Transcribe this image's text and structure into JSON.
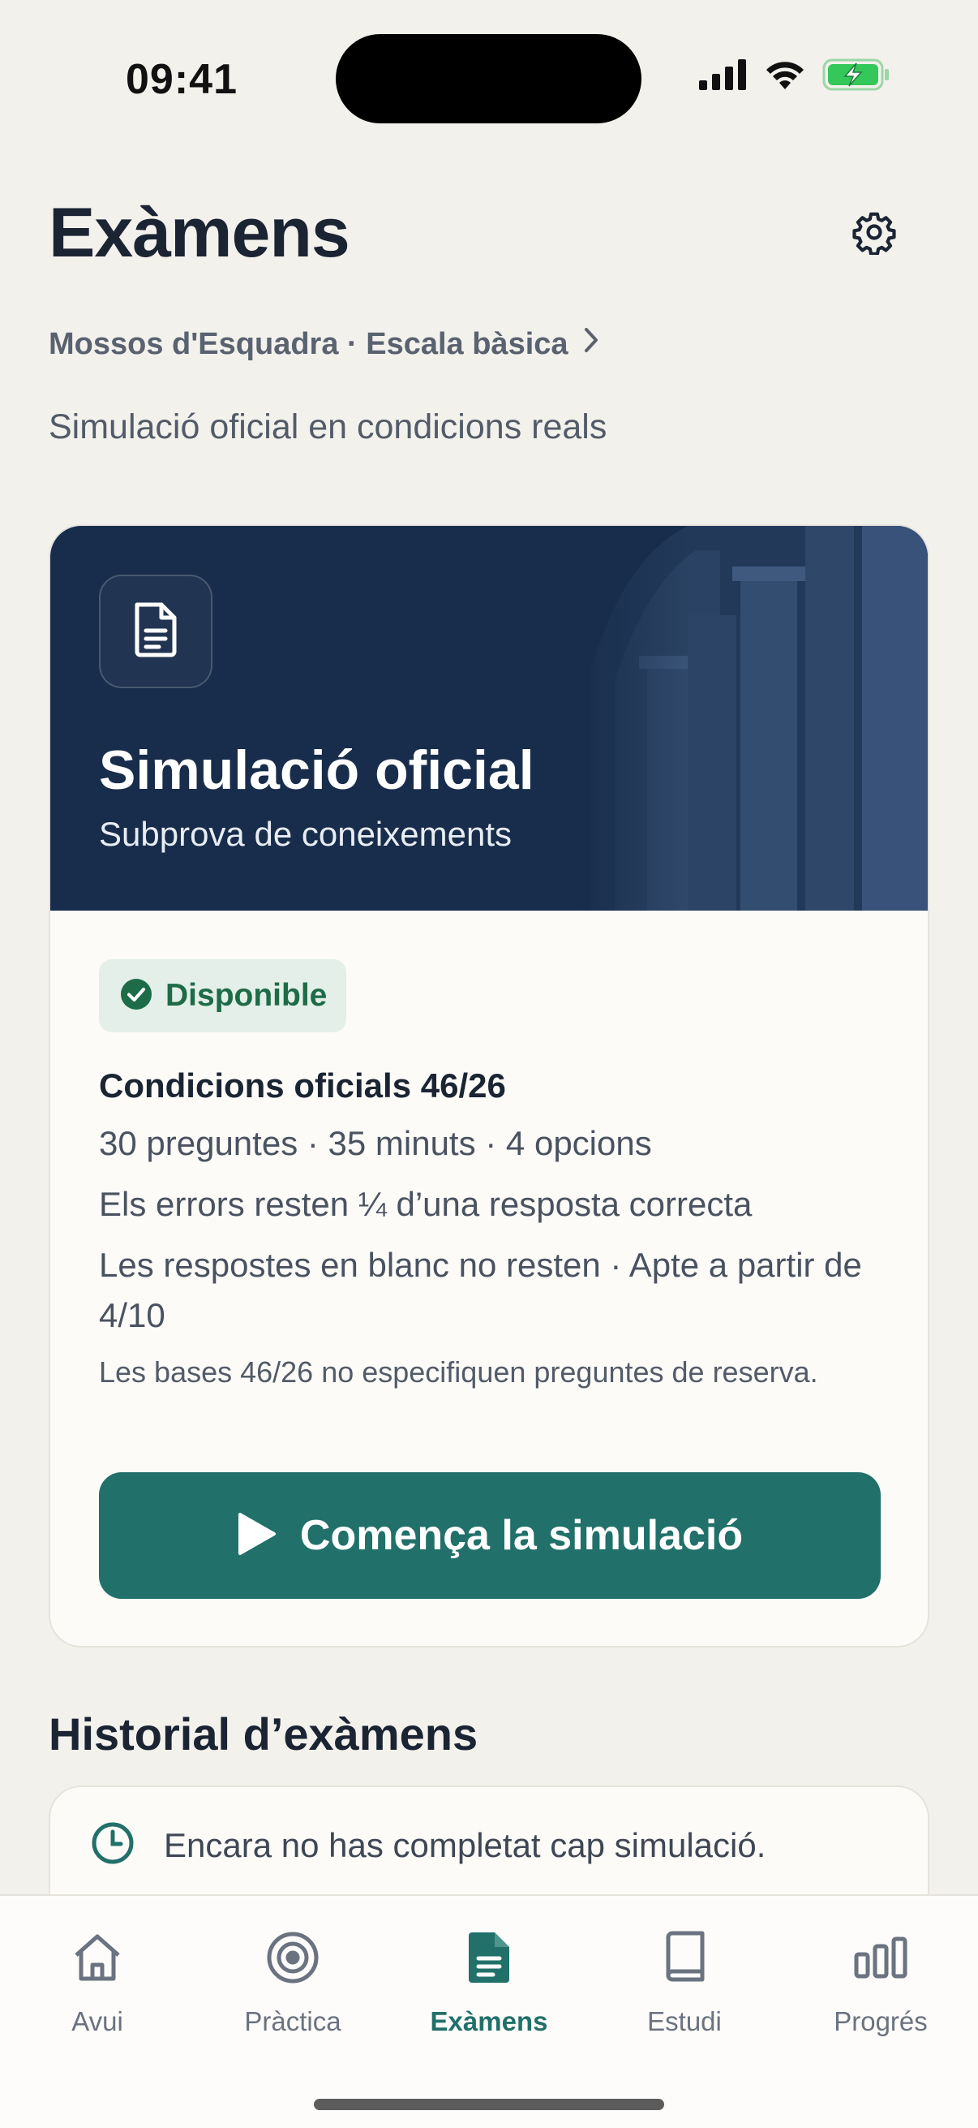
{
  "status_bar": {
    "time": "09:41",
    "icons": [
      "signal-icon",
      "wifi-icon",
      "battery-charging-icon"
    ]
  },
  "header": {
    "title": "Exàmens",
    "settings_icon": "gear-icon",
    "breadcrumb": "Mossos d'Esquadra · Escala bàsica",
    "subtitle": "Simulació oficial en condicions reals"
  },
  "simulation_card": {
    "hero_icon": "document-icon",
    "title": "Simulació oficial",
    "subtitle": "Subprova de coneixements",
    "badge": "Disponible",
    "conditions_title": "Condicions oficials 46/26",
    "lines": [
      "30 preguntes · 35 minuts · 4 opcions",
      "Els errors resten ¼ d’una resposta correcta",
      "Les respostes en blanc no resten · Apte a partir de 4/10"
    ],
    "note": "Les bases 46/26 no especifiquen preguntes de reserva.",
    "start_button": "Comença la simulació"
  },
  "history": {
    "title": "Historial d’exàmens",
    "empty_text": "Encara no has completat cap simulació."
  },
  "tab_bar": {
    "active": "Exàmens",
    "tabs": [
      {
        "label": "Avui",
        "icon": "home-icon"
      },
      {
        "label": "Pràctica",
        "icon": "target-icon"
      },
      {
        "label": "Exàmens",
        "icon": "document-icon"
      },
      {
        "label": "Estudi",
        "icon": "book-icon"
      },
      {
        "label": "Progrés",
        "icon": "bar-chart-icon"
      }
    ]
  },
  "colors": {
    "background": "#f3f1ec",
    "hero": "#182d4b",
    "accent": "#21706a",
    "badge_bg": "#e3efe8",
    "badge_text": "#1d6b47"
  }
}
